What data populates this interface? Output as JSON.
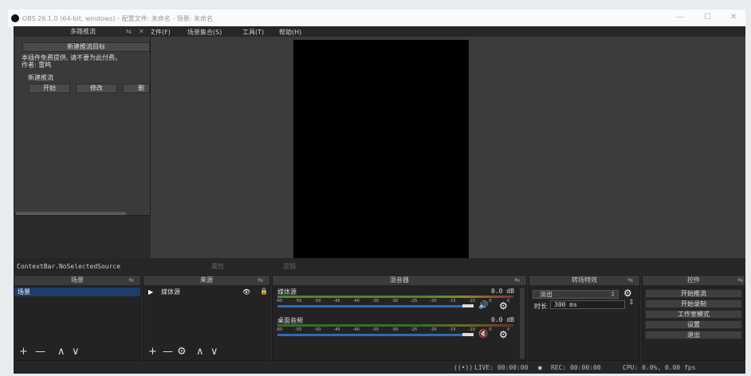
{
  "window": {
    "title": "OBS 26.1.0 (64-bit, windows) - 配置文件: 未命名 - 场景: 未命名",
    "minimize": "—",
    "maximize": "☐",
    "close": "✕"
  },
  "plugin": {
    "title": "多路推流",
    "new_target_button": "新建推流目标",
    "notice_line1": "本插件免费提供, 请不要为此付费。",
    "notice_line2": "作者: 雷鸣",
    "section_label": "新建推流",
    "start_button": "开始",
    "edit_button": "修改",
    "delete_button": "删除"
  },
  "menu": [
    "文件(F)",
    "场景集合(S)",
    "工具(T)",
    "帮助(H)"
  ],
  "context_bar": {
    "label": "ContextBar.NoSelectedSource",
    "properties_tab": "属性",
    "filters_tab": "滤镜"
  },
  "scenes": {
    "title": "场景",
    "items": [
      "场景"
    ]
  },
  "sources": {
    "title": "来源",
    "items": [
      "媒体源"
    ]
  },
  "mixer": {
    "title": "混音器",
    "tracks": [
      {
        "name": "媒体源",
        "db": "0.0 dB",
        "muted": false
      },
      {
        "name": "桌面音频",
        "db": "0.0 dB",
        "muted": true
      }
    ],
    "tick_labels": [
      "-60",
      "-55",
      "-50",
      "-45",
      "-40",
      "-35",
      "-30",
      "-25",
      "-20",
      "-15",
      "-10",
      "-5",
      "0"
    ]
  },
  "transitions": {
    "title": "转场特效",
    "selected": "淡出",
    "duration_label": "时长",
    "duration_value": "300 ms"
  },
  "controls": {
    "title": "控件",
    "buttons": [
      "开始推流",
      "开始录制",
      "工作室模式",
      "设置",
      "退出"
    ]
  },
  "status": {
    "live": "LIVE: 00:00:00",
    "rec": "REC: 00:00:00",
    "cpu": "CPU: 0.0%, 0.00 fps"
  },
  "colors": {
    "accent_blue": "#2b6bbf",
    "mute_red": "#e02020",
    "selected_row": "#1e3d6b"
  }
}
